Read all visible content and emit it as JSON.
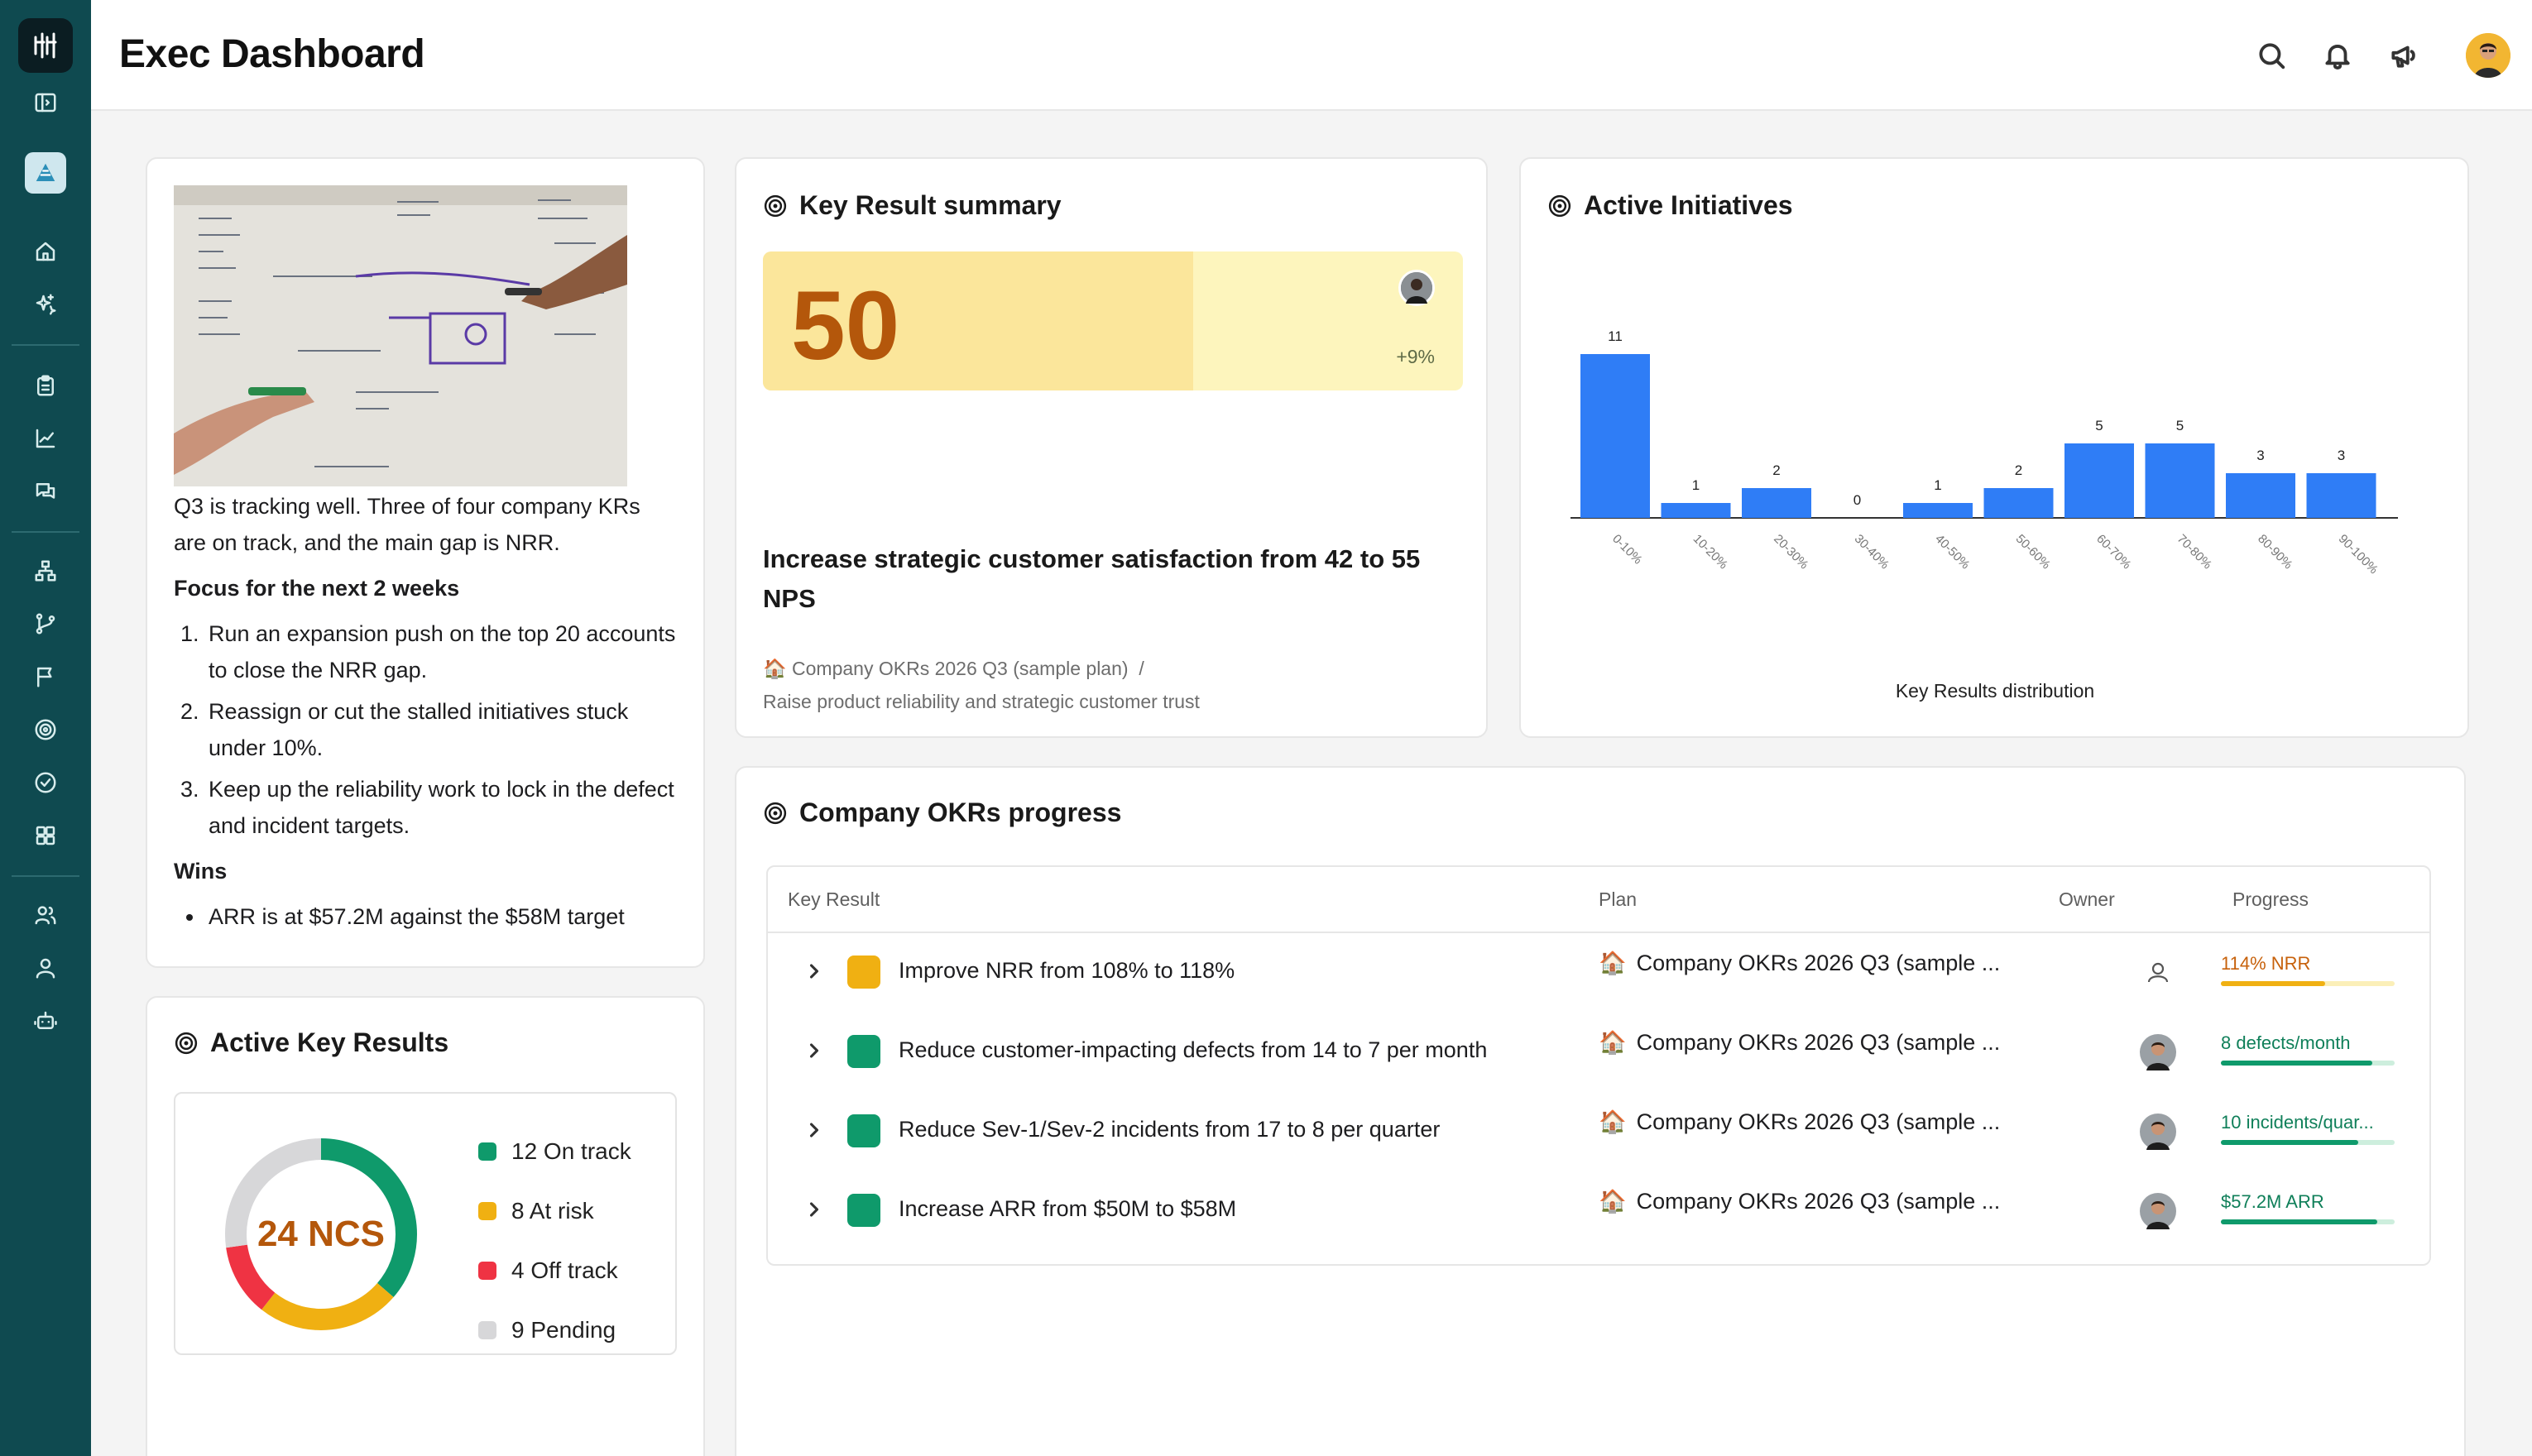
{
  "header": {
    "title": "Exec Dashboard"
  },
  "icons": {
    "sidebar": [
      "sidebar-toggle-icon",
      "okr-app-icon",
      "home-icon",
      "sparkle-icon",
      "clipboard-icon",
      "chart-icon",
      "chat-icon",
      "org-chart-icon",
      "branch-icon",
      "flag-icon",
      "target-icon",
      "check-circle-icon",
      "grid-icon",
      "people-icon",
      "user-group-icon",
      "robot-icon"
    ],
    "header": [
      "search-icon",
      "bell-icon",
      "megaphone-icon",
      "avatar"
    ]
  },
  "notes": {
    "intro": "Q3 is tracking well. Three of four company KRs are on track, and the main gap is NRR.",
    "focus_heading": "Focus for the next 2 weeks",
    "focus_items": [
      "Run an expansion push on the top 20 accounts to close the NRR gap.",
      "Reassign or cut the stalled initiatives stuck under 10%.",
      "Keep up the reliability work to lock in the defect and incident targets."
    ],
    "wins_heading": "Wins",
    "wins_first": "ARR is at $57.2M against the $58M target"
  },
  "kr_summary": {
    "title": "Key Result summary",
    "value": "50",
    "progress_fraction": 0.615,
    "delta": "+9%",
    "kr_title": "Increase strategic customer satisfaction from 42 to 55 NPS",
    "plan": "Company OKRs 2026 Q3 (sample plan)",
    "separator": "/",
    "objective": "Raise product reliability and strategic customer trust"
  },
  "initiatives": {
    "title": "Active Initiatives",
    "caption": "Key Results distribution"
  },
  "chart_data": {
    "type": "bar",
    "categories": [
      "0-10%",
      "10-20%",
      "20-30%",
      "30-40%",
      "40-50%",
      "50-60%",
      "60-70%",
      "70-80%",
      "80-90%",
      "90-100%"
    ],
    "values": [
      11,
      1,
      2,
      0,
      1,
      2,
      5,
      5,
      3,
      3
    ],
    "xlabel": "Key Results distribution",
    "ylim": [
      0,
      11
    ],
    "color": "#2f7df6"
  },
  "active_krs": {
    "title": "Active Key Results",
    "center_label": "24 NCS",
    "legend": [
      {
        "label": "12 On track",
        "count": 12,
        "color": "#0f9a6b"
      },
      {
        "label": "8 At risk",
        "count": 8,
        "color": "#f0b012"
      },
      {
        "label": "4 Off track",
        "count": 4,
        "color": "#ef3343"
      },
      {
        "label": "9 Pending",
        "count": 9,
        "color": "#d7d7d9"
      }
    ]
  },
  "okr_progress": {
    "title": "Company OKRs progress",
    "columns": [
      "Key Result",
      "Plan",
      "Owner",
      "Progress"
    ],
    "rows": [
      {
        "name": "Improve NRR from 108% to 118%",
        "color": "#f0b012",
        "plan": "Company OKRs 2026 Q3 (sample ...",
        "owner": "placeholder",
        "progress_label": "114% NRR",
        "progress": 0.6,
        "progress_color": "#c7610b",
        "bar_color": "#f0b012",
        "track_color": "#fbefb8"
      },
      {
        "name": "Reduce customer-impacting defects from 14 to 7 per month",
        "color": "#0f9a6b",
        "plan": "Company OKRs 2026 Q3 (sample ...",
        "owner": "person",
        "progress_label": "8 defects/month",
        "progress": 0.87,
        "progress_color": "#0f7f59",
        "bar_color": "#0f9a6b",
        "track_color": "#cdeedd"
      },
      {
        "name": "Reduce Sev-1/Sev-2 incidents from 17 to 8 per quarter",
        "color": "#0f9a6b",
        "plan": "Company OKRs 2026 Q3 (sample ...",
        "owner": "person",
        "progress_label": "10 incidents/quar...",
        "progress": 0.79,
        "progress_color": "#0f7f59",
        "bar_color": "#0f9a6b",
        "track_color": "#cdeedd"
      },
      {
        "name": "Increase ARR from $50M to $58M",
        "color": "#0f9a6b",
        "plan": "Company OKRs 2026 Q3 (sample ...",
        "owner": "person",
        "progress_label": "$57.2M ARR",
        "progress": 0.9,
        "progress_color": "#0f7f59",
        "bar_color": "#0f9a6b",
        "track_color": "#cdeedd"
      }
    ]
  }
}
